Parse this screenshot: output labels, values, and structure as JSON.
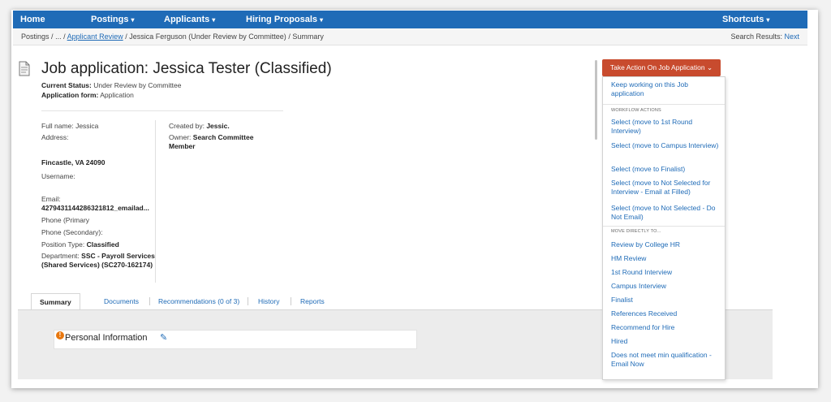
{
  "nav": {
    "home": "Home",
    "postings": "Postings",
    "applicants": "Applicants",
    "hiring_proposals": "Hiring Proposals",
    "shortcuts": "Shortcuts"
  },
  "breadcrumb": {
    "root": "Postings",
    "sep": "/",
    "ellipsis": "...",
    "applicant_review": "Applicant Review",
    "applicant": "Jessica Ferguson (Under Review by Committee)",
    "current": "Summary"
  },
  "search_results": {
    "label": "Search Results:",
    "next": "Next"
  },
  "page": {
    "title": "Job application: Jessica Tester (Classified)",
    "status_label": "Current Status:",
    "status_value": "Under Review by Committee",
    "form_label": "Application form:",
    "form_value": "Application"
  },
  "applicant": {
    "full_name_label": "Full name:",
    "full_name": "Jessica",
    "address_label": "Address:",
    "city": "Fincastle, VA 24090",
    "username_label": "Username:",
    "email_label": "Email:",
    "email": "4279431144286321812_emailad...",
    "phone_primary_label": "Phone (Primary",
    "phone_secondary_label": "Phone (Secondary):",
    "position_type_label": "Position Type:",
    "position_type": "Classified",
    "department_label": "Department:",
    "department": "SSC - Payroll Services (Shared Services) (SC270-162174)",
    "created_by_label": "Created by:",
    "created_by": "Jessic.",
    "owner_label": "Owner:",
    "owner": "Search Committee Member"
  },
  "tabs": [
    {
      "label": "Summary"
    },
    {
      "label": "Documents"
    },
    {
      "label": "Recommendations (0 of 3)"
    },
    {
      "label": "History"
    },
    {
      "label": "Reports"
    }
  ],
  "section": {
    "personal_info": "Personal Information"
  },
  "actions": {
    "button": "Take Action On Job Application",
    "keep_working": "Keep working on this Job application",
    "workflow_heading": "WORKFLOW ACTIONS",
    "workflow": [
      "Select (move to 1st Round Interview)",
      "Select (move to Campus Interview)",
      "Select (move to Finalist)",
      "Select (move to Not Selected for Interview - Email at Filled)",
      "Select (move to Not Selected - Do Not Email)"
    ],
    "move_heading": "MOVE DIRECTLY TO...",
    "move": [
      "Review by College HR",
      "HM Review",
      "1st Round Interview",
      "Campus Interview",
      "Finalist",
      "References Received",
      "Recommend for Hire",
      "Hired",
      "Does not meet min qualification - Email Now"
    ]
  },
  "colors": {
    "nav": "#1f6bb7",
    "action_button": "#c84b2e",
    "link": "#1f6bb7",
    "warning": "#e8770e"
  }
}
